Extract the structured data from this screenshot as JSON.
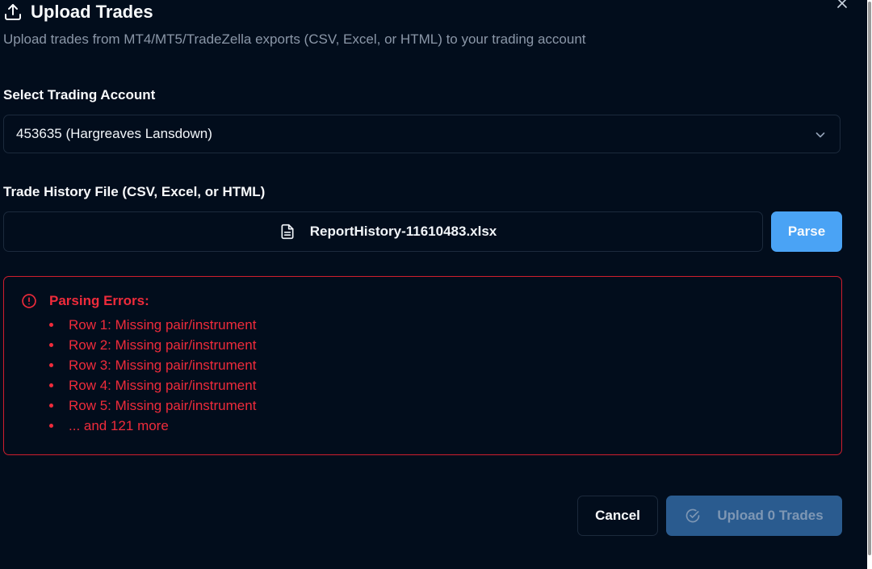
{
  "dialog": {
    "title": "Upload Trades",
    "subtitle": "Upload trades from MT4/MT5/TradeZella exports (CSV, Excel, or HTML) to your trading account",
    "icons": {
      "title": "upload-icon",
      "close": "close-icon"
    }
  },
  "account": {
    "label": "Select Trading Account",
    "selected": "453635 (Hargreaves Lansdown)",
    "icon": "chevron-down-icon"
  },
  "file": {
    "label": "Trade History File (CSV, Excel, or HTML)",
    "filename": "ReportHistory-11610483.xlsx",
    "icon": "file-icon",
    "parse_label": "Parse"
  },
  "errors": {
    "title": "Parsing Errors:",
    "icon": "alert-circle-icon",
    "items": [
      "Row 1: Missing pair/instrument",
      "Row 2: Missing pair/instrument",
      "Row 3: Missing pair/instrument",
      "Row 4: Missing pair/instrument",
      "Row 5: Missing pair/instrument",
      "... and 121 more"
    ]
  },
  "footer": {
    "cancel_label": "Cancel",
    "upload_label": "Upload 0 Trades",
    "upload_icon": "check-circle-icon",
    "upload_disabled": true
  },
  "colors": {
    "background": "#020d1c",
    "primary": "#4aa3f5",
    "error": "#ef2b3b",
    "border": "#1c2a3c",
    "disabled_button": "#2a5b8f"
  }
}
